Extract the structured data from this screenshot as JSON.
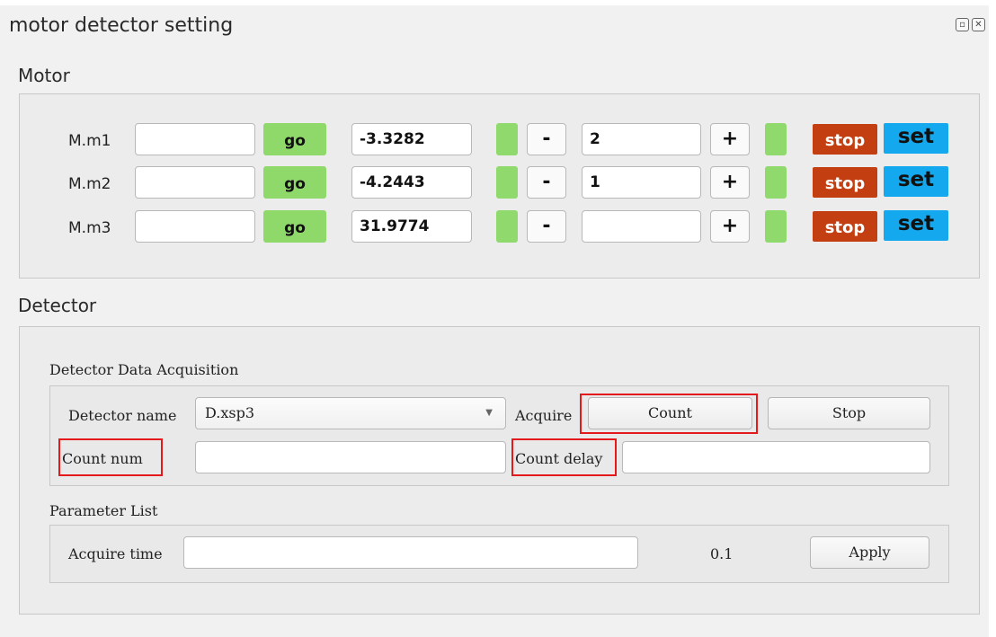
{
  "window": {
    "title": "motor detector setting",
    "icons": [
      "float-icon",
      "close-icon"
    ]
  },
  "motor": {
    "label": "Motor",
    "go_label": "go",
    "minus_label": "-",
    "plus_label": "+",
    "stop_label": "stop",
    "set_label": "set",
    "rows": [
      {
        "name": "M.m1",
        "target": "",
        "position": "-3.3282",
        "step": "2"
      },
      {
        "name": "M.m2",
        "target": "",
        "position": "-4.2443",
        "step": "1"
      },
      {
        "name": "M.m3",
        "target": "",
        "position": "31.9774",
        "step": ""
      }
    ]
  },
  "detector": {
    "label": "Detector",
    "acquisition": {
      "title": "Detector Data Acquisition",
      "detector_name_label": "Detector name",
      "detector_name_value": "D.xsp3",
      "acquire_label": "Acquire",
      "count_button": "Count",
      "stop_button": "Stop",
      "count_num_label": "Count num",
      "count_num_value": "",
      "count_delay_label": "Count delay",
      "count_delay_value": ""
    },
    "parameters": {
      "title": "Parameter List",
      "acquire_time_label": "Acquire time",
      "acquire_time_input": "",
      "acquire_time_value": "0.1",
      "apply_button": "Apply"
    }
  },
  "colors": {
    "go": "#8fd86a",
    "led": "#90d96d",
    "stop": "#c33e10",
    "set": "#14a8ee",
    "highlight": "#e3191b"
  }
}
